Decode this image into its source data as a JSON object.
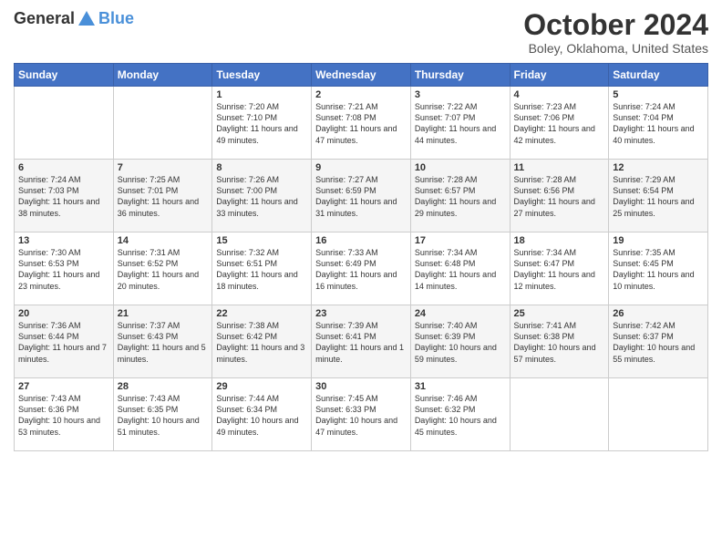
{
  "header": {
    "logo_line1": "General",
    "logo_line2": "Blue",
    "title": "October 2024",
    "location": "Boley, Oklahoma, United States"
  },
  "weekdays": [
    "Sunday",
    "Monday",
    "Tuesday",
    "Wednesday",
    "Thursday",
    "Friday",
    "Saturday"
  ],
  "weeks": [
    [
      {
        "day": "",
        "sunrise": "",
        "sunset": "",
        "daylight": ""
      },
      {
        "day": "",
        "sunrise": "",
        "sunset": "",
        "daylight": ""
      },
      {
        "day": "1",
        "sunrise": "Sunrise: 7:20 AM",
        "sunset": "Sunset: 7:10 PM",
        "daylight": "Daylight: 11 hours and 49 minutes."
      },
      {
        "day": "2",
        "sunrise": "Sunrise: 7:21 AM",
        "sunset": "Sunset: 7:08 PM",
        "daylight": "Daylight: 11 hours and 47 minutes."
      },
      {
        "day": "3",
        "sunrise": "Sunrise: 7:22 AM",
        "sunset": "Sunset: 7:07 PM",
        "daylight": "Daylight: 11 hours and 44 minutes."
      },
      {
        "day": "4",
        "sunrise": "Sunrise: 7:23 AM",
        "sunset": "Sunset: 7:06 PM",
        "daylight": "Daylight: 11 hours and 42 minutes."
      },
      {
        "day": "5",
        "sunrise": "Sunrise: 7:24 AM",
        "sunset": "Sunset: 7:04 PM",
        "daylight": "Daylight: 11 hours and 40 minutes."
      }
    ],
    [
      {
        "day": "6",
        "sunrise": "Sunrise: 7:24 AM",
        "sunset": "Sunset: 7:03 PM",
        "daylight": "Daylight: 11 hours and 38 minutes."
      },
      {
        "day": "7",
        "sunrise": "Sunrise: 7:25 AM",
        "sunset": "Sunset: 7:01 PM",
        "daylight": "Daylight: 11 hours and 36 minutes."
      },
      {
        "day": "8",
        "sunrise": "Sunrise: 7:26 AM",
        "sunset": "Sunset: 7:00 PM",
        "daylight": "Daylight: 11 hours and 33 minutes."
      },
      {
        "day": "9",
        "sunrise": "Sunrise: 7:27 AM",
        "sunset": "Sunset: 6:59 PM",
        "daylight": "Daylight: 11 hours and 31 minutes."
      },
      {
        "day": "10",
        "sunrise": "Sunrise: 7:28 AM",
        "sunset": "Sunset: 6:57 PM",
        "daylight": "Daylight: 11 hours and 29 minutes."
      },
      {
        "day": "11",
        "sunrise": "Sunrise: 7:28 AM",
        "sunset": "Sunset: 6:56 PM",
        "daylight": "Daylight: 11 hours and 27 minutes."
      },
      {
        "day": "12",
        "sunrise": "Sunrise: 7:29 AM",
        "sunset": "Sunset: 6:54 PM",
        "daylight": "Daylight: 11 hours and 25 minutes."
      }
    ],
    [
      {
        "day": "13",
        "sunrise": "Sunrise: 7:30 AM",
        "sunset": "Sunset: 6:53 PM",
        "daylight": "Daylight: 11 hours and 23 minutes."
      },
      {
        "day": "14",
        "sunrise": "Sunrise: 7:31 AM",
        "sunset": "Sunset: 6:52 PM",
        "daylight": "Daylight: 11 hours and 20 minutes."
      },
      {
        "day": "15",
        "sunrise": "Sunrise: 7:32 AM",
        "sunset": "Sunset: 6:51 PM",
        "daylight": "Daylight: 11 hours and 18 minutes."
      },
      {
        "day": "16",
        "sunrise": "Sunrise: 7:33 AM",
        "sunset": "Sunset: 6:49 PM",
        "daylight": "Daylight: 11 hours and 16 minutes."
      },
      {
        "day": "17",
        "sunrise": "Sunrise: 7:34 AM",
        "sunset": "Sunset: 6:48 PM",
        "daylight": "Daylight: 11 hours and 14 minutes."
      },
      {
        "day": "18",
        "sunrise": "Sunrise: 7:34 AM",
        "sunset": "Sunset: 6:47 PM",
        "daylight": "Daylight: 11 hours and 12 minutes."
      },
      {
        "day": "19",
        "sunrise": "Sunrise: 7:35 AM",
        "sunset": "Sunset: 6:45 PM",
        "daylight": "Daylight: 11 hours and 10 minutes."
      }
    ],
    [
      {
        "day": "20",
        "sunrise": "Sunrise: 7:36 AM",
        "sunset": "Sunset: 6:44 PM",
        "daylight": "Daylight: 11 hours and 7 minutes."
      },
      {
        "day": "21",
        "sunrise": "Sunrise: 7:37 AM",
        "sunset": "Sunset: 6:43 PM",
        "daylight": "Daylight: 11 hours and 5 minutes."
      },
      {
        "day": "22",
        "sunrise": "Sunrise: 7:38 AM",
        "sunset": "Sunset: 6:42 PM",
        "daylight": "Daylight: 11 hours and 3 minutes."
      },
      {
        "day": "23",
        "sunrise": "Sunrise: 7:39 AM",
        "sunset": "Sunset: 6:41 PM",
        "daylight": "Daylight: 11 hours and 1 minute."
      },
      {
        "day": "24",
        "sunrise": "Sunrise: 7:40 AM",
        "sunset": "Sunset: 6:39 PM",
        "daylight": "Daylight: 10 hours and 59 minutes."
      },
      {
        "day": "25",
        "sunrise": "Sunrise: 7:41 AM",
        "sunset": "Sunset: 6:38 PM",
        "daylight": "Daylight: 10 hours and 57 minutes."
      },
      {
        "day": "26",
        "sunrise": "Sunrise: 7:42 AM",
        "sunset": "Sunset: 6:37 PM",
        "daylight": "Daylight: 10 hours and 55 minutes."
      }
    ],
    [
      {
        "day": "27",
        "sunrise": "Sunrise: 7:43 AM",
        "sunset": "Sunset: 6:36 PM",
        "daylight": "Daylight: 10 hours and 53 minutes."
      },
      {
        "day": "28",
        "sunrise": "Sunrise: 7:43 AM",
        "sunset": "Sunset: 6:35 PM",
        "daylight": "Daylight: 10 hours and 51 minutes."
      },
      {
        "day": "29",
        "sunrise": "Sunrise: 7:44 AM",
        "sunset": "Sunset: 6:34 PM",
        "daylight": "Daylight: 10 hours and 49 minutes."
      },
      {
        "day": "30",
        "sunrise": "Sunrise: 7:45 AM",
        "sunset": "Sunset: 6:33 PM",
        "daylight": "Daylight: 10 hours and 47 minutes."
      },
      {
        "day": "31",
        "sunrise": "Sunrise: 7:46 AM",
        "sunset": "Sunset: 6:32 PM",
        "daylight": "Daylight: 10 hours and 45 minutes."
      },
      {
        "day": "",
        "sunrise": "",
        "sunset": "",
        "daylight": ""
      },
      {
        "day": "",
        "sunrise": "",
        "sunset": "",
        "daylight": ""
      }
    ]
  ]
}
